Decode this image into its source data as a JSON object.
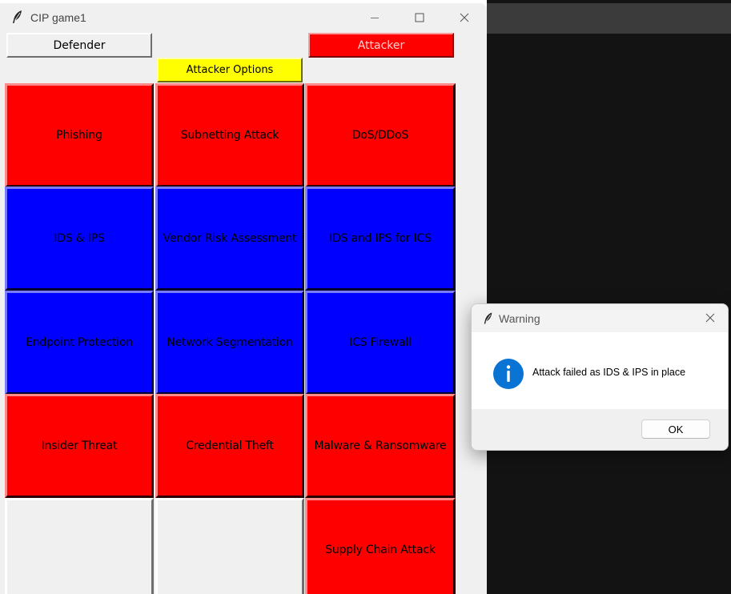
{
  "window": {
    "title": "CIP game1"
  },
  "roles": {
    "defender_label": "Defender",
    "attacker_label": "Attacker"
  },
  "options": {
    "label": "Attacker Options"
  },
  "grid": [
    {
      "label": "Phishing",
      "kind": "attack"
    },
    {
      "label": "Subnetting Attack",
      "kind": "attack"
    },
    {
      "label": "DoS/DDoS",
      "kind": "attack"
    },
    {
      "label": "IDS & IPS",
      "kind": "defense"
    },
    {
      "label": "Vendor Risk Assessment",
      "kind": "defense"
    },
    {
      "label": "IDS and IPS for ICS",
      "kind": "defense"
    },
    {
      "label": "Endpoint Protection",
      "kind": "defense"
    },
    {
      "label": "Network Segmentation",
      "kind": "defense"
    },
    {
      "label": "ICS Firewall",
      "kind": "defense"
    },
    {
      "label": "Insider Threat",
      "kind": "attack"
    },
    {
      "label": "Credential Theft",
      "kind": "attack"
    },
    {
      "label": "Malware & Ransomware",
      "kind": "attack"
    },
    {
      "label": "",
      "kind": "empty"
    },
    {
      "label": "",
      "kind": "empty"
    },
    {
      "label": "Supply Chain Attack",
      "kind": "attack"
    }
  ],
  "dialog": {
    "title": "Warning",
    "message": "Attack failed as IDS & IPS in place",
    "ok_label": "OK",
    "icon": "info-icon"
  },
  "colors": {
    "attack": "#ff0000",
    "defense": "#0000ff",
    "empty": "#f0f0f0",
    "options_bg": "#ffff00",
    "attacker_bg": "#ff0000",
    "attacker_text": "#ffd0d0",
    "info_blue": "#0a74d4"
  }
}
